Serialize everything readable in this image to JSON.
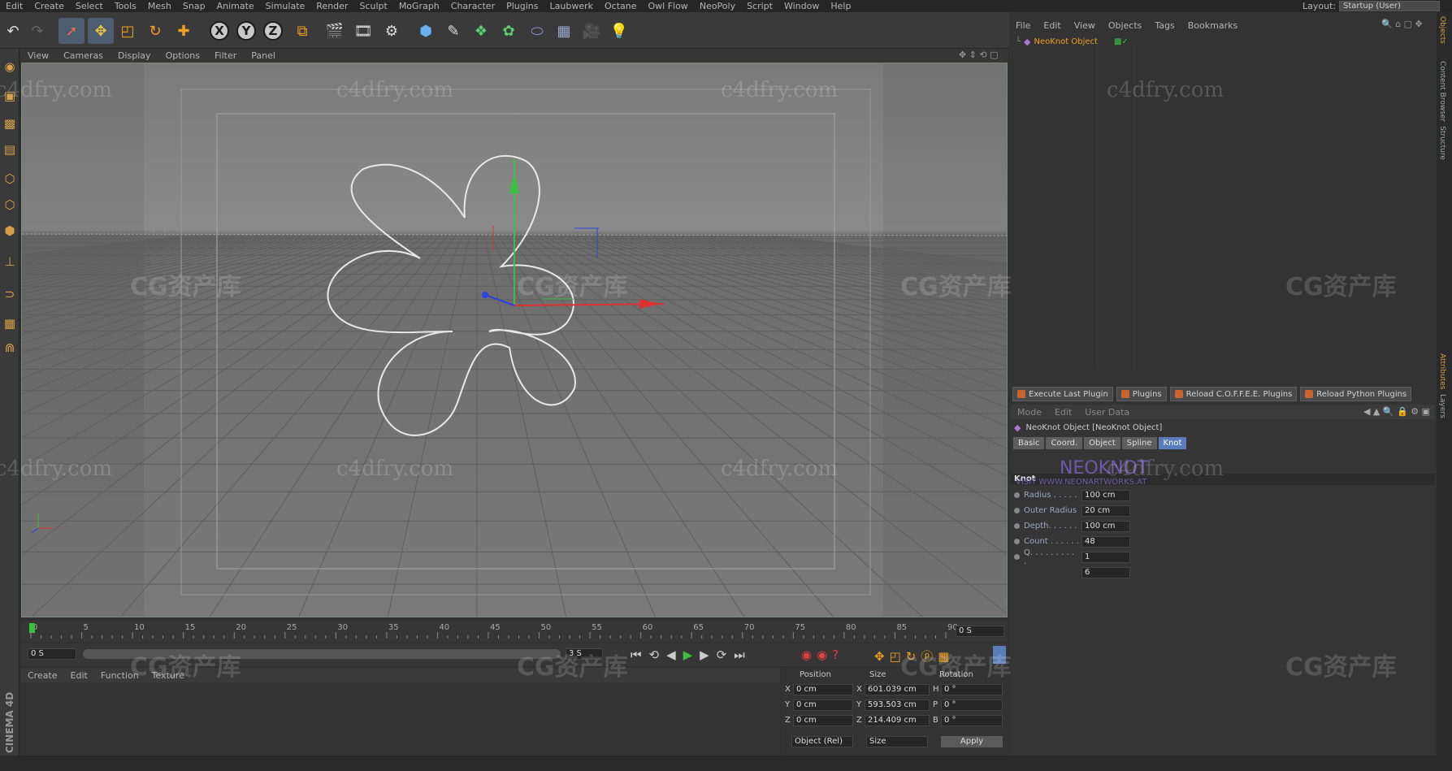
{
  "menubar": {
    "items": [
      "Edit",
      "Create",
      "Select",
      "Tools",
      "Mesh",
      "Snap",
      "Animate",
      "Simulate",
      "Render",
      "Sculpt",
      "MoGraph",
      "Character",
      "Plugins",
      "Laubwerk",
      "Octane",
      "Owl Flow",
      "NeoPoly",
      "Script",
      "Window",
      "Help"
    ],
    "layout_label": "Layout:",
    "layout_value": "Startup (User)"
  },
  "viewport": {
    "menu": [
      "View",
      "Cameras",
      "Display",
      "Options",
      "Filter",
      "Panel"
    ]
  },
  "timeline": {
    "ticks": [
      "0",
      "5",
      "10",
      "15",
      "20",
      "25",
      "30",
      "35",
      "40",
      "45",
      "50",
      "55",
      "60",
      "65",
      "70",
      "75",
      "80",
      "85",
      "90"
    ],
    "end_frame": "0 S",
    "start_field": "0 S",
    "mid_field": "3 S"
  },
  "material": {
    "menu": [
      "Create",
      "Edit",
      "Function",
      "Texture"
    ],
    "brand": "CINEMA 4D"
  },
  "coords": {
    "headers": [
      "Position",
      "Size",
      "Rotation"
    ],
    "rows": [
      {
        "axis": "X",
        "pos": "0 cm",
        "size": "601.039 cm",
        "rot_axis": "H",
        "rot": "0 °"
      },
      {
        "axis": "Y",
        "pos": "0 cm",
        "size": "593.503 cm",
        "rot_axis": "P",
        "rot": "0 °"
      },
      {
        "axis": "Z",
        "pos": "0 cm",
        "size": "214.409 cm",
        "rot_axis": "B",
        "rot": "0 °"
      }
    ],
    "mode": "Object (Rel)",
    "size_mode": "Size",
    "apply": "Apply"
  },
  "objects": {
    "menu": [
      "File",
      "Edit",
      "View",
      "Objects",
      "Tags",
      "Bookmarks"
    ],
    "item": "NeoKnot Object"
  },
  "plugins": [
    "Execute Last Plugin",
    "Plugins",
    "Reload C.O.F.F.E.E. Plugins",
    "Reload Python Plugins"
  ],
  "attributes": {
    "menu": [
      "Mode",
      "Edit",
      "User Data"
    ],
    "title": "NeoKnot Object [NeoKnot Object]",
    "tabs": [
      "Basic",
      "Coord.",
      "Object",
      "Spline",
      "Knot"
    ],
    "logo": "NEOKNOT",
    "logo_url": "VISIT WWW.NEONARTWORKS.AT",
    "section": "Knot",
    "params": [
      {
        "label": "Radius . . . . .",
        "value": "100 cm"
      },
      {
        "label": "Outer Radius",
        "value": "20 cm"
      },
      {
        "label": "Depth. . . . . .",
        "value": "100 cm"
      },
      {
        "label": "Count . . . . . .",
        "value": "48"
      },
      {
        "label": "Q. . . . . . . . . .",
        "value": "1"
      },
      {
        "label": "",
        "value": "6"
      }
    ]
  },
  "side_tabs": [
    "Objects",
    "Content Browser",
    "Structure",
    "Attributes",
    "Layers"
  ],
  "watermarks": {
    "site": "c4dfry.com",
    "cg": "CG资产库"
  },
  "colors": {
    "accent": "#5a7cba",
    "orange": "#d6a04a"
  }
}
